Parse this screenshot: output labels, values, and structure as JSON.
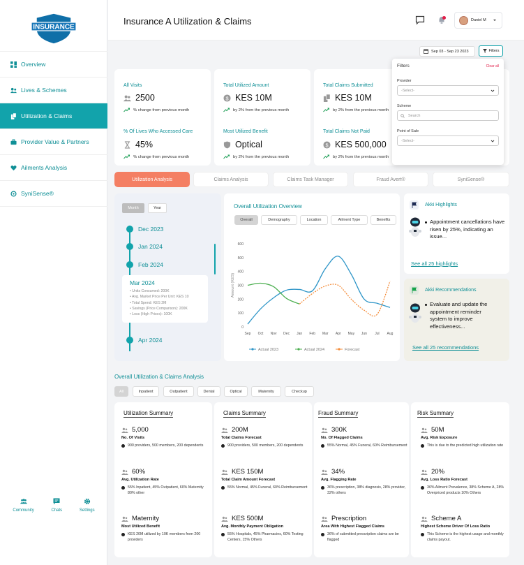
{
  "brand": {
    "logo_text": "INSURANCE",
    "accent": "#12a3ab",
    "tab_active": "#f47f63"
  },
  "nav": {
    "items": [
      {
        "label": "Overview",
        "icon": "grid-icon"
      },
      {
        "label": "Lives & Schemes",
        "icon": "users-icon"
      },
      {
        "label": "Utilization & Claims",
        "icon": "docs-icon",
        "active": true
      },
      {
        "label": "Provider Value & Partners",
        "icon": "briefcase-icon"
      },
      {
        "label": "Ailments Analysis",
        "icon": "heart-icon"
      },
      {
        "label": "SyniSense®",
        "icon": "sync-icon"
      }
    ],
    "footer": [
      {
        "label": "Community"
      },
      {
        "label": "Chats"
      },
      {
        "label": "Settings"
      }
    ]
  },
  "header": {
    "title": "Insurance A Utilization & Claims",
    "user_name": "Daniel M"
  },
  "toolbar": {
    "date_range": "Sep 03 - Sep 23 2023",
    "filters_label": "Filters"
  },
  "filters_panel": {
    "title": "Filters",
    "clear": "Clear all",
    "provider_label": "Provider",
    "provider_value": "-Select-",
    "scheme_label": "Scheme",
    "scheme_placeholder": "Search",
    "pos_label": "Point of Sale",
    "pos_value": "-Select-"
  },
  "stats": [
    {
      "title": "All Visits",
      "value": "2500",
      "sub": "% change from previous month"
    },
    {
      "title": "% Of Lives Who Accessed Care",
      "value": "45%",
      "sub": "% change from previous month"
    },
    {
      "title": "Total Utilized Amount",
      "value": "KES 10M",
      "sub": "by 2% from the previous month"
    },
    {
      "title": "Most Utilized Benefit",
      "value": "Optical",
      "sub": "by 2% from the previous month"
    },
    {
      "title": "Total Claims Submitted",
      "value": "KES 10M",
      "sub": "by 2% from the previous month"
    },
    {
      "title": "Total Claims Not Paid",
      "value": "KES 500,000",
      "sub": "by 2% from the previous month"
    }
  ],
  "tabs": [
    "Utilization Analysis",
    "Claims Analysis",
    "Claims Task Manager",
    "Fraud Avert®",
    "SyniSense®"
  ],
  "timeline": {
    "toggle": [
      "Month",
      "Year"
    ],
    "months": [
      "Dec 2023",
      "Jan 2024",
      "Feb 2024"
    ],
    "selected": {
      "title": "Mar 2024",
      "lines": [
        "Units Consumed: 200K",
        "Avg. Market Price Per Unit: KES 10",
        "Total Spend: KES 2M",
        "Savings (Price Comparison): 200K",
        "Loss (High Prices): 100K"
      ]
    },
    "next": "Apr 2024"
  },
  "chart_card": {
    "title": "Overall Utilization Overview",
    "tabs": [
      "Overall",
      "Demography",
      "Location",
      "Ailment Type",
      "Benefits"
    ]
  },
  "chart_data": {
    "type": "line",
    "categories": [
      "Sep",
      "Oct",
      "Nov",
      "Dec",
      "Jan",
      "Feb",
      "Mar",
      "Apr",
      "May",
      "Jun",
      "Jul",
      "Aug"
    ],
    "ylabel": "Amount (KES)",
    "yticks": [
      "0",
      "100",
      "200",
      "300",
      "400",
      "500",
      "600"
    ],
    "ylim": [
      0,
      600
    ],
    "series": [
      {
        "name": "Actual 2023",
        "color": "#2f96c8",
        "dash": false,
        "values": [
          20,
          130,
          210,
          265,
          270,
          260,
          420,
          510,
          380,
          200,
          170,
          140
        ]
      },
      {
        "name": "Actual 2024",
        "color": "#4caf50",
        "dash": false,
        "values": [
          300,
          315,
          290,
          205,
          165
        ]
      },
      {
        "name": "Forecast",
        "color": "#f48c3a",
        "dash": true,
        "start": 4,
        "values": [
          165,
          240,
          295,
          300,
          200,
          120,
          90,
          330
        ]
      }
    ]
  },
  "akki_highlights": {
    "title": "Akki Highlights",
    "text": "Appointment cancellations have risen by 25%, indicating an issue...",
    "link": "See all 25 highlights"
  },
  "akki_recs": {
    "title": "Akki Recommendations",
    "text": "Evaluate and update the appointment reminder system to improve effectiveness...",
    "link": "See all 25 recommendations"
  },
  "section_title": "Overall Utilization & Claims Analysis",
  "chips": [
    "All",
    "Inpatient",
    "Outpatient",
    "Dental",
    "Optical",
    "Maternity",
    "Checkup"
  ],
  "summaries": [
    {
      "title": "Utilization Summary",
      "metrics": [
        {
          "value": "5,000",
          "label": "No. Of Visits",
          "desc": "900 providers, 500 members, 200 dependents"
        },
        {
          "value": "60%",
          "label": "Avg. Utilization Rate",
          "desc": "55% Inpatient, 45% Outpatient, 60% Maternity 80% other"
        },
        {
          "value": "Maternity",
          "label": "Most Utilized Benefit",
          "desc": "KES 20M utilized by 10K members from 200 providers"
        }
      ]
    },
    {
      "title": "Claims Summary",
      "metrics": [
        {
          "value": "200M",
          "label": "Total Claims Forecast",
          "desc": "900 providers, 500 members, 200 dependents"
        },
        {
          "value": "KES 150M",
          "label": "Total Claim Amount Forecast",
          "desc": "55% Normal, 45% Funeral, 60% Reimbursement"
        },
        {
          "value": "KES 500M",
          "label": "Avg. Monthly Payment Obligation",
          "desc": "55% Hospitals, 45% Pharmacies, 60% Testing Centers, 15% Others"
        }
      ]
    },
    {
      "title": "Fraud Summary",
      "metrics": [
        {
          "value": "300K",
          "label": "No. Of Flagged Claims",
          "desc": "55% Normal, 45% Funeral, 60% Reimbursement"
        },
        {
          "value": "34%",
          "label": "Avg. Flagging Rate",
          "desc": "36% prescription, 38% diagnosis, 28% provider, 32% others"
        },
        {
          "value": "Prescription",
          "label": "Area With Highest Flagged Claims",
          "desc": "36% of submitted prescription claims are be flagged"
        }
      ]
    },
    {
      "title": "Risk Summary",
      "metrics": [
        {
          "value": "50M",
          "label": "Avg. Risk Exposure",
          "desc": "This is due to the predicted high utilization rate"
        },
        {
          "value": "20%",
          "label": "Avg. Loss Ratio Forecast",
          "desc": "36% Ailment Prevalence, 38% Scheme A, 28% Overpriced products 10% Others"
        },
        {
          "value": "Scheme A",
          "label": "Highest Scheme Driver Of Loss Ratio",
          "desc": "This Scheme is the highest usage and monthly claims payout."
        }
      ]
    }
  ]
}
